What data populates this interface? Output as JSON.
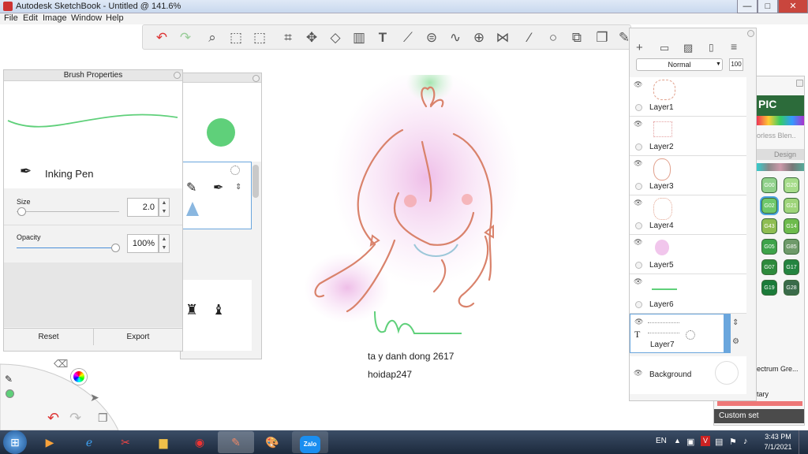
{
  "window": {
    "title": "Autodesk SketchBook - Untitled @ 141.6%",
    "min": "—",
    "max": "□",
    "close": "✕"
  },
  "menu": [
    "File",
    "Edit",
    "Image",
    "Window",
    "Help"
  ],
  "toolbar": {
    "icons": [
      "undo-icon",
      "redo-icon",
      "zoom-icon",
      "select-icon",
      "transform-icon",
      "crop-icon",
      "move-icon",
      "distort-icon",
      "fill-icon",
      "text-icon",
      "ruler-icon",
      "ellipse-guide-icon",
      "french-curve-icon",
      "perspective-icon",
      "symmetry-icon",
      "stroke-icon",
      "shape-icon",
      "copic-icon",
      "layers-icon",
      "brush-library-icon"
    ]
  },
  "brush_properties": {
    "title": "Brush Properties",
    "brush_name": "Inking Pen",
    "size_label": "Size",
    "size_value": "2.0",
    "opacity_label": "Opacity",
    "opacity_value": "100%",
    "reset": "Reset",
    "export": "Export"
  },
  "brush_library": {
    "current_color": "#5fd07a"
  },
  "layers": {
    "blend_mode": "Normal",
    "opacity": "100",
    "rows": [
      {
        "name": "Layer1",
        "tag": ""
      },
      {
        "name": "Layer2",
        "tag": ""
      },
      {
        "name": "Layer3",
        "tag": ""
      },
      {
        "name": "Layer4",
        "tag": ""
      },
      {
        "name": "Layer5",
        "tag": ""
      },
      {
        "name": "Layer6",
        "tag": ""
      },
      {
        "name": "Layer7",
        "tag": "T"
      }
    ],
    "background_label": "Background"
  },
  "copic": {
    "logo": "PIC",
    "hint": "orless Blen..",
    "tab_design": "Design",
    "swatches": [
      {
        "label": "G00",
        "color": "#8fd08a"
      },
      {
        "label": "G20",
        "color": "#a6dc8a"
      },
      {
        "label": "G02",
        "color": "#6ec86b"
      },
      {
        "label": "G21",
        "color": "#9ed47a"
      },
      {
        "label": "G43",
        "color": "#8fbd52"
      },
      {
        "label": "G14",
        "color": "#6dbb4c"
      },
      {
        "label": "G05",
        "color": "#3ea34a"
      },
      {
        "label": "G85",
        "color": "#6f9a6a"
      },
      {
        "label": "G07",
        "color": "#2e8a3c"
      },
      {
        "label": "G17",
        "color": "#248440"
      },
      {
        "label": "G19",
        "color": "#1b7b3a"
      },
      {
        "label": "G28",
        "color": "#3a6b4a"
      }
    ],
    "spectrum": "ectrum Gre...",
    "tary": "tary",
    "custom_set": "Custom set"
  },
  "canvas": {
    "line1": "ta y danh dong 2617",
    "line2": "hoidap247"
  },
  "taskbar": {
    "lang": "EN",
    "time": "3:43 PM",
    "date": "7/1/2021"
  }
}
